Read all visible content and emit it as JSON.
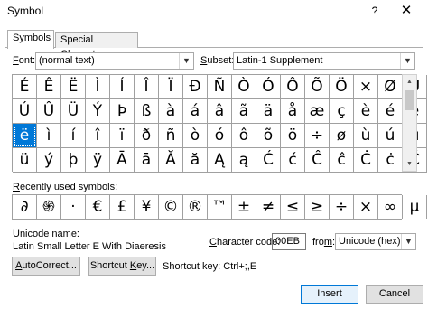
{
  "window": {
    "title": "Symbol",
    "help_label": "?",
    "close_label": "✕"
  },
  "tabs": [
    {
      "label": "Symbols",
      "active": true
    },
    {
      "label": "Special Characters",
      "active": false
    }
  ],
  "font": {
    "label_pre": "F",
    "label_post": "ont:",
    "value": "(normal text)"
  },
  "subset": {
    "label_pre": "S",
    "label_post": "ubset:",
    "value": "Latin-1 Supplement"
  },
  "symbol_grid": [
    [
      "É",
      "Ê",
      "Ë",
      "Ì",
      "Í",
      "Î",
      "Ï",
      "Đ",
      "Ñ",
      "Ò",
      "Ó",
      "Ô",
      "Õ",
      "Ö",
      "×",
      "Ø",
      "Ù"
    ],
    [
      "Ú",
      "Û",
      "Ü",
      "Ý",
      "Þ",
      "ß",
      "à",
      "á",
      "â",
      "ã",
      "ä",
      "å",
      "æ",
      "ç",
      "è",
      "é",
      "ê"
    ],
    [
      "ë",
      "ì",
      "í",
      "î",
      "ï",
      "ð",
      "ñ",
      "ò",
      "ó",
      "ô",
      "õ",
      "ö",
      "÷",
      "ø",
      "ù",
      "ú",
      "û"
    ],
    [
      "ü",
      "ý",
      "þ",
      "ÿ",
      "Ā",
      "ā",
      "Ă",
      "ă",
      "Ą",
      "ą",
      "Ć",
      "ć",
      "Ĉ",
      "ĉ",
      "Ċ",
      "ċ",
      "Č"
    ]
  ],
  "selected_cell": {
    "row": 2,
    "col": 0
  },
  "recent": {
    "label_pre": "R",
    "label_post": "ecently used symbols:",
    "symbols": [
      "∂",
      "֍",
      "·",
      "€",
      "£",
      "¥",
      "©",
      "®",
      "™",
      "±",
      "≠",
      "≤",
      "≥",
      "÷",
      "×",
      "∞",
      "µ"
    ]
  },
  "unicode_name": {
    "label": "Unicode name:",
    "value": "Latin Small Letter E With Diaeresis"
  },
  "character_code": {
    "label_pre": "C",
    "label_post": "haracter code:",
    "value": "00EB"
  },
  "from": {
    "label_pre": "fro",
    "label_u": "m",
    "label_post": ":",
    "value": "Unicode (hex)"
  },
  "buttons": {
    "autocorrect_pre": "A",
    "autocorrect_post": "utoCorrect...",
    "shortcut_pre": "Shortcut ",
    "shortcut_u": "K",
    "shortcut_post": "ey...",
    "insert": "Insert",
    "cancel": "Cancel"
  },
  "shortcut_key_text": "Shortcut key: Ctrl+;,E"
}
